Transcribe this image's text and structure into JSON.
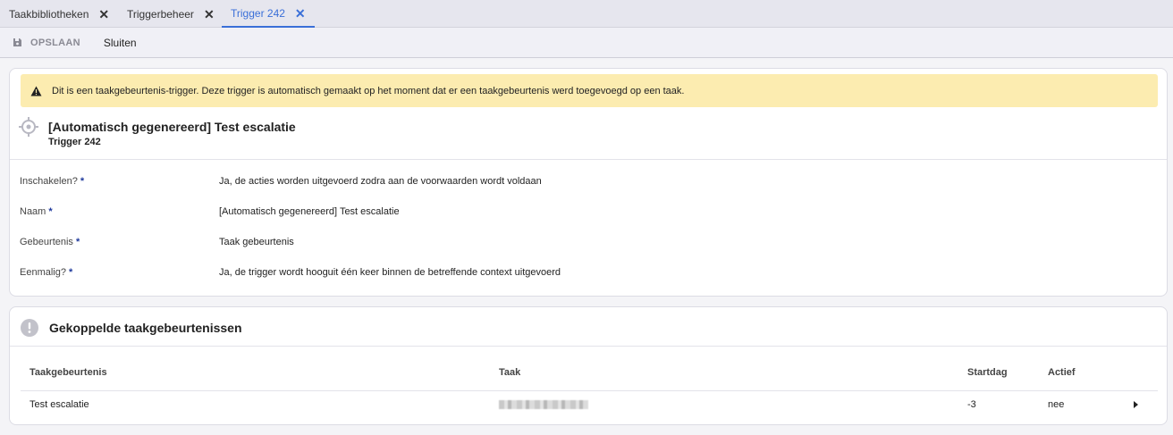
{
  "tabs": [
    {
      "label": "Taakbibliotheken",
      "active": false
    },
    {
      "label": "Triggerbeheer",
      "active": false
    },
    {
      "label": "Trigger 242",
      "active": true
    }
  ],
  "toolbar": {
    "save_label": "OPSLAAN",
    "close_label": "Sluiten"
  },
  "warning": {
    "text": "Dit is een taakgebeurtenis-trigger. Deze trigger is automatisch gemaakt op het moment dat er een taakgebeurtenis werd toegevoegd op een taak."
  },
  "trigger": {
    "title": "[Automatisch gegenereerd] Test escalatie",
    "subtitle": "Trigger 242"
  },
  "fields": [
    {
      "label": "Inschakelen?",
      "required": "*",
      "value": "Ja, de acties worden uitgevoerd zodra aan de voorwaarden wordt voldaan"
    },
    {
      "label": "Naam",
      "required": "*",
      "value": "[Automatisch gegenereerd] Test escalatie"
    },
    {
      "label": "Gebeurtenis",
      "required": "*",
      "value": "Taak gebeurtenis"
    },
    {
      "label": "Eenmalig?",
      "required": "*",
      "value": "Ja, de trigger wordt hooguit één keer binnen de betreffende context uitgevoerd"
    }
  ],
  "linked": {
    "title": "Gekoppelde taakgebeurtenissen",
    "columns": [
      "Taakgebeurtenis",
      "Taak",
      "Startdag",
      "Actief"
    ],
    "rows": [
      {
        "taakgebeurtenis": "Test escalatie",
        "taak": "",
        "startdag": "-3",
        "actief": "nee"
      }
    ]
  },
  "colors": {
    "accent": "#3a6fd8",
    "warning_bg": "#fcecb0",
    "required": "#1f3a9c"
  },
  "icons": {
    "save": "save-icon",
    "close": "close-icon",
    "warning": "warning-icon",
    "trigger": "crosshair-icon",
    "linked": "alert-circle-icon",
    "row": "caret-right-icon"
  }
}
